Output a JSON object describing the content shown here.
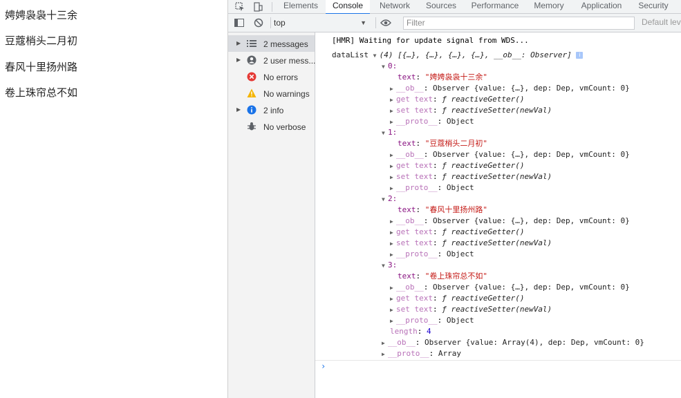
{
  "page": {
    "lines": [
      "娉娉袅袅十三余",
      "豆蔻梢头二月初",
      "春风十里扬州路",
      "卷上珠帘总不如"
    ]
  },
  "devtools": {
    "tabs": [
      "Elements",
      "Console",
      "Network",
      "Sources",
      "Performance",
      "Memory",
      "Application",
      "Security"
    ],
    "active_tab": "Console",
    "toolbar": {
      "context": "top",
      "filter_placeholder": "Filter",
      "levels": "Default lev"
    },
    "sidebar": [
      {
        "label": "2 messages",
        "icon": "list-icon",
        "expandable": true,
        "selected": true
      },
      {
        "label": "2 user mess...",
        "icon": "user-icon",
        "expandable": true,
        "selected": false
      },
      {
        "label": "No errors",
        "icon": "error-icon",
        "expandable": false,
        "selected": false
      },
      {
        "label": "No warnings",
        "icon": "warning-icon",
        "expandable": false,
        "selected": false
      },
      {
        "label": "2 info",
        "icon": "info-icon",
        "expandable": true,
        "selected": false
      },
      {
        "label": "No verbose",
        "icon": "bug-icon",
        "expandable": false,
        "selected": false
      }
    ],
    "console": {
      "hmr": "[HMR] Waiting for update signal from WDS...",
      "datalist_name": "dataList",
      "datalist_summary": "(4) [{…}, {…}, {…}, {…}, __ob__: Observer]",
      "info_badge": "i",
      "items": [
        {
          "index": "0:",
          "text": "\"娉娉袅袅十三余\""
        },
        {
          "index": "1:",
          "text": "\"豆蔻梢头二月初\""
        },
        {
          "index": "2:",
          "text": "\"春风十里扬州路\""
        },
        {
          "index": "3:",
          "text": "\"卷上珠帘总不如\""
        }
      ],
      "labels": {
        "text_key": "text",
        "ob_key": "__ob__",
        "ob_value": "Observer {value: {…}, dep: Dep, vmCount: 0}",
        "get_key": "get text",
        "get_value": "reactiveGetter()",
        "set_key": "set text",
        "set_value": "reactiveSetter(newVal)",
        "f_symbol": "ƒ",
        "proto_key": "__proto__",
        "proto_object": "Object",
        "length_key": "length",
        "length_value": "4",
        "arr_ob_value": "Observer {value: Array(4), dep: Dep, vmCount: 0}",
        "proto_array": "Array"
      },
      "prompt": "›"
    },
    "colors": {
      "accent": "#1a73e8",
      "property_key": "#881280",
      "string": "#c41a16",
      "number": "#1c00cf",
      "error": "#e53935",
      "warning": "#f4b400",
      "info": "#1a73e8"
    }
  }
}
